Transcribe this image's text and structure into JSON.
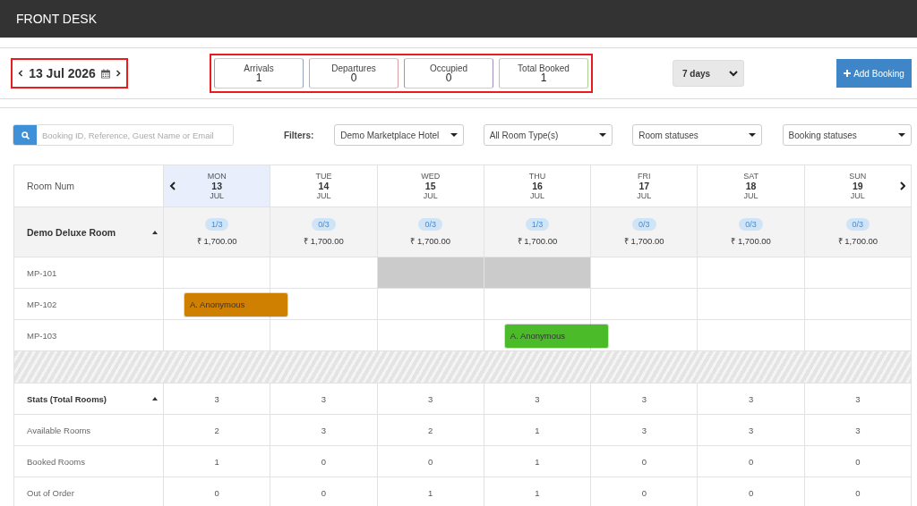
{
  "app_bar": {
    "title": "FRONT DESK"
  },
  "date_nav": {
    "date": "13 Jul 2026",
    "highlighted": true
  },
  "summary": {
    "highlighted": true,
    "cards": [
      {
        "label": "Arrivals",
        "value": "1",
        "color": "#8fa4b8"
      },
      {
        "label": "Departures",
        "value": "0",
        "color": "#d9a0a0"
      },
      {
        "label": "Occupied",
        "value": "0",
        "color": "#a48fc0"
      },
      {
        "label": "Total Booked",
        "value": "1",
        "color": "#a8d08f"
      }
    ]
  },
  "range_select": {
    "value": "7 days"
  },
  "add_button": {
    "label": "Add Booking"
  },
  "search": {
    "placeholder": "Booking ID, Reference, Guest Name or Email"
  },
  "filters": {
    "label": "Filters:",
    "selects": [
      {
        "value": "Demo Marketplace Hotel"
      },
      {
        "value": "All Room Type(s)"
      },
      {
        "value": "Room statuses"
      },
      {
        "value": "Booking statuses"
      }
    ]
  },
  "grid": {
    "corner": "Room Num",
    "days": [
      {
        "weekday": "MON",
        "day": "13",
        "month": "JUL",
        "selected": true
      },
      {
        "weekday": "TUE",
        "day": "14",
        "month": "JUL",
        "selected": false
      },
      {
        "weekday": "WED",
        "day": "15",
        "month": "JUL",
        "selected": false
      },
      {
        "weekday": "THU",
        "day": "16",
        "month": "JUL",
        "selected": false
      },
      {
        "weekday": "FRI",
        "day": "17",
        "month": "JUL",
        "selected": false
      },
      {
        "weekday": "SAT",
        "day": "18",
        "month": "JUL",
        "selected": false
      },
      {
        "weekday": "SUN",
        "day": "19",
        "month": "JUL",
        "selected": false
      }
    ],
    "room_type": {
      "name": "Demo Deluxe Room",
      "expanded": true,
      "days": [
        {
          "availability": "1/3",
          "rate": "₹ 1,700.00"
        },
        {
          "availability": "0/3",
          "rate": "₹ 1,700.00"
        },
        {
          "availability": "0/3",
          "rate": "₹ 1,700.00"
        },
        {
          "availability": "1/3",
          "rate": "₹ 1,700.00"
        },
        {
          "availability": "0/3",
          "rate": "₹ 1,700.00"
        },
        {
          "availability": "0/3",
          "rate": "₹ 1,700.00"
        },
        {
          "availability": "0/3",
          "rate": "₹ 1,700.00"
        }
      ]
    },
    "rooms": [
      {
        "name": "MP-101",
        "cells": [
          {
            "blocked": false
          },
          {
            "blocked": false
          },
          {
            "blocked": true
          },
          {
            "blocked": true
          },
          {
            "blocked": false
          },
          {
            "blocked": false
          },
          {
            "blocked": false
          }
        ]
      },
      {
        "name": "MP-102",
        "cells": [
          {
            "blocked": false,
            "booking": {
              "guest": "A. Anonymous",
              "color": "#d08000"
            }
          },
          {
            "blocked": false
          },
          {
            "blocked": false
          },
          {
            "blocked": false
          },
          {
            "blocked": false
          },
          {
            "blocked": false
          },
          {
            "blocked": false
          }
        ]
      },
      {
        "name": "MP-103",
        "cells": [
          {
            "blocked": false
          },
          {
            "blocked": false
          },
          {
            "blocked": false
          },
          {
            "blocked": false,
            "booking": {
              "guest": "A. Anonymous",
              "color": "#4cbb2a"
            }
          },
          {
            "blocked": false
          },
          {
            "blocked": false
          },
          {
            "blocked": false
          }
        ]
      }
    ],
    "stats": {
      "expanded": true,
      "rows": [
        {
          "kind": "header",
          "label": "Stats (Total Rooms)",
          "values": [
            "3",
            "3",
            "3",
            "3",
            "3",
            "3",
            "3"
          ]
        },
        {
          "kind": "metric",
          "label": "Available Rooms",
          "values": [
            "2",
            "3",
            "2",
            "1",
            "3",
            "3",
            "3"
          ]
        },
        {
          "kind": "metric",
          "label": "Booked Rooms",
          "values": [
            "1",
            "0",
            "0",
            "1",
            "0",
            "0",
            "0"
          ]
        },
        {
          "kind": "metric",
          "label": "Out of Order",
          "values": [
            "0",
            "0",
            "1",
            "1",
            "0",
            "0",
            "0"
          ]
        }
      ]
    }
  }
}
